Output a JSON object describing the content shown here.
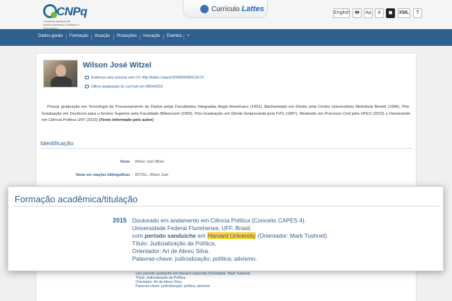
{
  "header": {
    "logo_text": "CNPq",
    "logo_subtitle": "Conselho Nacional de Desenvolvimento Científico e Tecnológico",
    "curriculo_prefix": "Currículo",
    "curriculo_brand": "Lattes",
    "tools": [
      {
        "name": "english-button",
        "label": "English"
      },
      {
        "name": "print-icon",
        "label": "🖶"
      },
      {
        "name": "font-size-icon",
        "label": "Aa"
      },
      {
        "name": "font-decrease-icon",
        "label": "A"
      },
      {
        "name": "contrast-icon",
        "label": "◼"
      },
      {
        "name": "xml-button",
        "label": "XML"
      },
      {
        "name": "help-button",
        "label": "?"
      }
    ]
  },
  "nav": {
    "items": [
      "Dados gerais",
      "Formação",
      "Atuação",
      "Produções",
      "Inovação",
      "Eventos",
      "+"
    ]
  },
  "profile": {
    "name": "Wilson José Witzel",
    "cv_address": "Endereço para acessar este CV: http://lattes.cnpq.br/2946505082618176",
    "last_update": "Última atualização do currículo em 08/04/2016",
    "bio_text": "Possui graduação em Tecnologia de Processamento de Dados pelas Faculdades Integradas Anglo Americano (1991), Bacharelado em Direito pela Centro Universitário Metodista Benett (1996), Pós-Graduação em Docência para o Ensino Superior pela Faculdade Bittencourt (1993), Pós-Graduação em Direito Empresarial pela FVG (1997), Mestrado em Processo Civil pela UFES (2010) e Doutorando em Ciência Política UFF (2015)",
    "bio_note": "(Texto informado pelo autor)"
  },
  "identificacao": {
    "title": "Identificação",
    "fields": [
      {
        "label": "Nome",
        "value": "Wilson José Witzel"
      },
      {
        "label": "Nome em citações bibliográficas",
        "value": "WITZEL, Wilson José"
      }
    ]
  },
  "underlying_entry": {
    "lines": [
      "com período sanduíche em Harvard University (Orientador: Mark Tushnet).",
      "Título: Judicialização da Política,",
      "Orientador: Ari de Abreu Silva.",
      "Palavras-chave: judicialização; política; ativismo."
    ]
  },
  "formacao_zoom": {
    "title": "Formação acadêmica/titulação",
    "year": "2015",
    "line1": "Doutorado em andamento em Ciência Política (Conceito CAPES 4).",
    "line2": "Universidade Federal Fluminense, UFF, Brasil.",
    "line3_prefix": "com",
    "line3_bold": "período sanduíche",
    "line3_mid": "em",
    "line3_highlight": "Harvard University",
    "line3_suffix": "(Orientador: Mark Tushnet).",
    "line4": "Título: Judicialização da Política,",
    "line5": "Orientador: Ari de Abreu Silva.",
    "line6": "Palavras-chave: judicialização; política; ativismo.",
    "highlight_color": "#ffd43a"
  }
}
